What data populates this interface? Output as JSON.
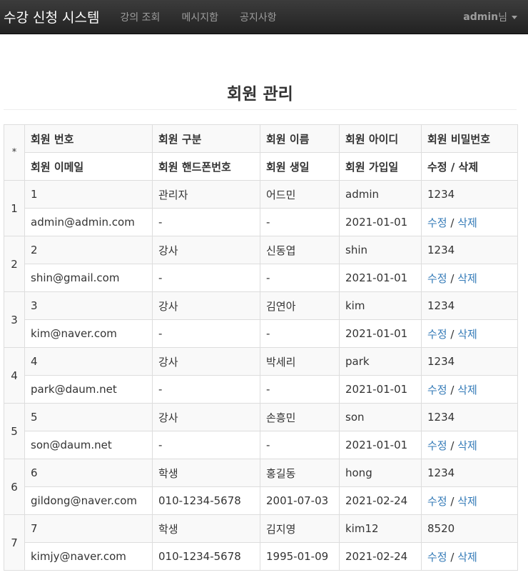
{
  "navbar": {
    "brand": "수강 신청 시스템",
    "links": [
      "강의 조회",
      "메시지함",
      "공지사항"
    ],
    "user_name": "admin",
    "user_suffix": "님"
  },
  "page": {
    "title": "회원 관리"
  },
  "table": {
    "corner": "*",
    "header_row1": [
      "회원 번호",
      "회원 구분",
      "회원 이름",
      "회원 아이디",
      "회원 비밀번호"
    ],
    "header_row2": [
      "회원 이메일",
      "회원 핸드폰번호",
      "회원 생일",
      "회원 가입일",
      "수정 / 삭제"
    ],
    "edit_label": "수정",
    "delete_label": "삭제",
    "separator": "/",
    "rows": [
      {
        "idx": "1",
        "no": "1",
        "type": "관리자",
        "name": "어드민",
        "id": "admin",
        "pw": "1234",
        "email": "admin@admin.com",
        "phone": "-",
        "birth": "-",
        "joined": "2021-01-01"
      },
      {
        "idx": "2",
        "no": "2",
        "type": "강사",
        "name": "신동엽",
        "id": "shin",
        "pw": "1234",
        "email": "shin@gmail.com",
        "phone": "-",
        "birth": "-",
        "joined": "2021-01-01"
      },
      {
        "idx": "3",
        "no": "3",
        "type": "강사",
        "name": "김연아",
        "id": "kim",
        "pw": "1234",
        "email": "kim@naver.com",
        "phone": "-",
        "birth": "-",
        "joined": "2021-01-01"
      },
      {
        "idx": "4",
        "no": "4",
        "type": "강사",
        "name": "박세리",
        "id": "park",
        "pw": "1234",
        "email": "park@daum.net",
        "phone": "-",
        "birth": "-",
        "joined": "2021-01-01"
      },
      {
        "idx": "5",
        "no": "5",
        "type": "강사",
        "name": "손흥민",
        "id": "son",
        "pw": "1234",
        "email": "son@daum.net",
        "phone": "-",
        "birth": "-",
        "joined": "2021-01-01"
      },
      {
        "idx": "6",
        "no": "6",
        "type": "학생",
        "name": "홍길동",
        "id": "hong",
        "pw": "1234",
        "email": "gildong@naver.com",
        "phone": "010-1234-5678",
        "birth": "2001-07-03",
        "joined": "2021-02-24"
      },
      {
        "idx": "7",
        "no": "7",
        "type": "학생",
        "name": "김지영",
        "id": "kim12",
        "pw": "8520",
        "email": "kimjy@naver.com",
        "phone": "010-1234-5678",
        "birth": "1995-01-09",
        "joined": "2021-02-24"
      }
    ]
  }
}
